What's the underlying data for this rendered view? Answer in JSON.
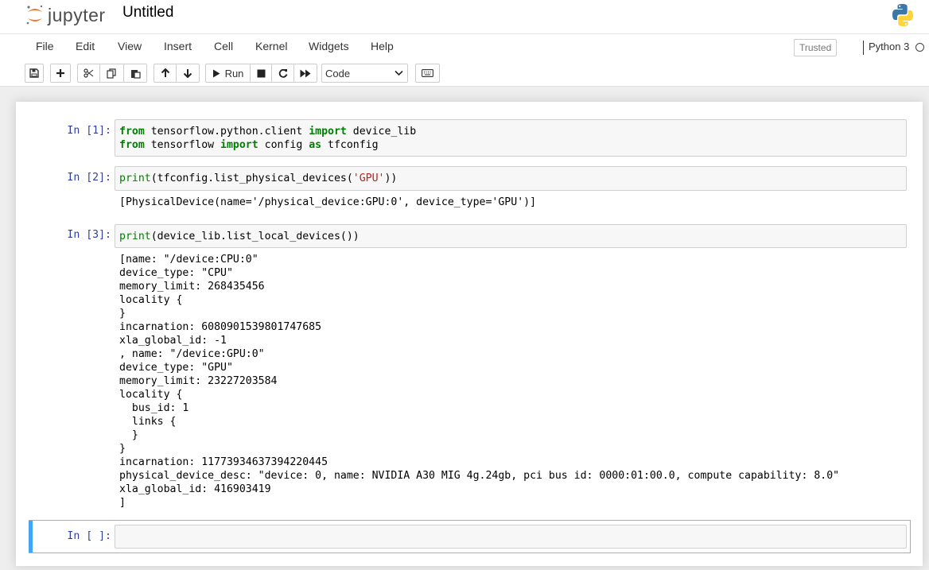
{
  "header": {
    "logo_text": "jupyter",
    "notebook_name": "Untitled"
  },
  "menu": {
    "items": [
      "File",
      "Edit",
      "View",
      "Insert",
      "Cell",
      "Kernel",
      "Widgets",
      "Help"
    ],
    "trusted": "Trusted",
    "kernel_name": "Python 3"
  },
  "toolbar": {
    "run_label": "Run",
    "cell_type": "Code",
    "buttons": [
      "save-icon",
      "plus-icon",
      "cut-icon",
      "copy-icon",
      "paste-icon",
      "arrow-up-icon",
      "arrow-down-icon",
      "play-icon",
      "stop-icon",
      "restart-icon",
      "fast-forward-icon",
      "keyboard-icon"
    ]
  },
  "cells": [
    {
      "prompt": "In [1]:",
      "code": [
        [
          {
            "t": "from",
            "c": "kw"
          },
          {
            "t": " tensorflow.python.client ",
            "c": ""
          },
          {
            "t": "import",
            "c": "kw"
          },
          {
            "t": " device_lib",
            "c": ""
          }
        ],
        [
          {
            "t": "from",
            "c": "kw"
          },
          {
            "t": " tensorflow ",
            "c": ""
          },
          {
            "t": "import",
            "c": "kw"
          },
          {
            "t": " config ",
            "c": ""
          },
          {
            "t": "as",
            "c": "kw"
          },
          {
            "t": " tfconfig",
            "c": ""
          }
        ]
      ],
      "output": []
    },
    {
      "prompt": "In [2]:",
      "code": [
        [
          {
            "t": "print",
            "c": "nb"
          },
          {
            "t": "(tfconfig.list_physical_devices(",
            "c": ""
          },
          {
            "t": "'GPU'",
            "c": "st"
          },
          {
            "t": "))",
            "c": ""
          }
        ]
      ],
      "output": [
        "[PhysicalDevice(name='/physical_device:GPU:0', device_type='GPU')]"
      ]
    },
    {
      "prompt": "In [3]:",
      "code": [
        [
          {
            "t": "print",
            "c": "nb"
          },
          {
            "t": "(device_lib.list_local_devices())",
            "c": ""
          }
        ]
      ],
      "output": [
        "[name: \"/device:CPU:0\"",
        "device_type: \"CPU\"",
        "memory_limit: 268435456",
        "locality {",
        "}",
        "incarnation: 6080901539801747685",
        "xla_global_id: -1",
        ", name: \"/device:GPU:0\"",
        "device_type: \"GPU\"",
        "memory_limit: 23227203584",
        "locality {",
        "  bus_id: 1",
        "  links {",
        "  }",
        "}",
        "incarnation: 11773934637394220445",
        "physical_device_desc: \"device: 0, name: NVIDIA A30 MIG 4g.24gb, pci bus id: 0000:01:00.0, compute capability: 8.0\"",
        "xla_global_id: 416903419",
        "]"
      ]
    },
    {
      "prompt": "In [ ]:",
      "code": [],
      "output": []
    }
  ],
  "colors": {
    "prompt": "#303f9f",
    "keyword": "#008000",
    "string": "#ba2121",
    "selected_cell": "#42a5f5"
  }
}
